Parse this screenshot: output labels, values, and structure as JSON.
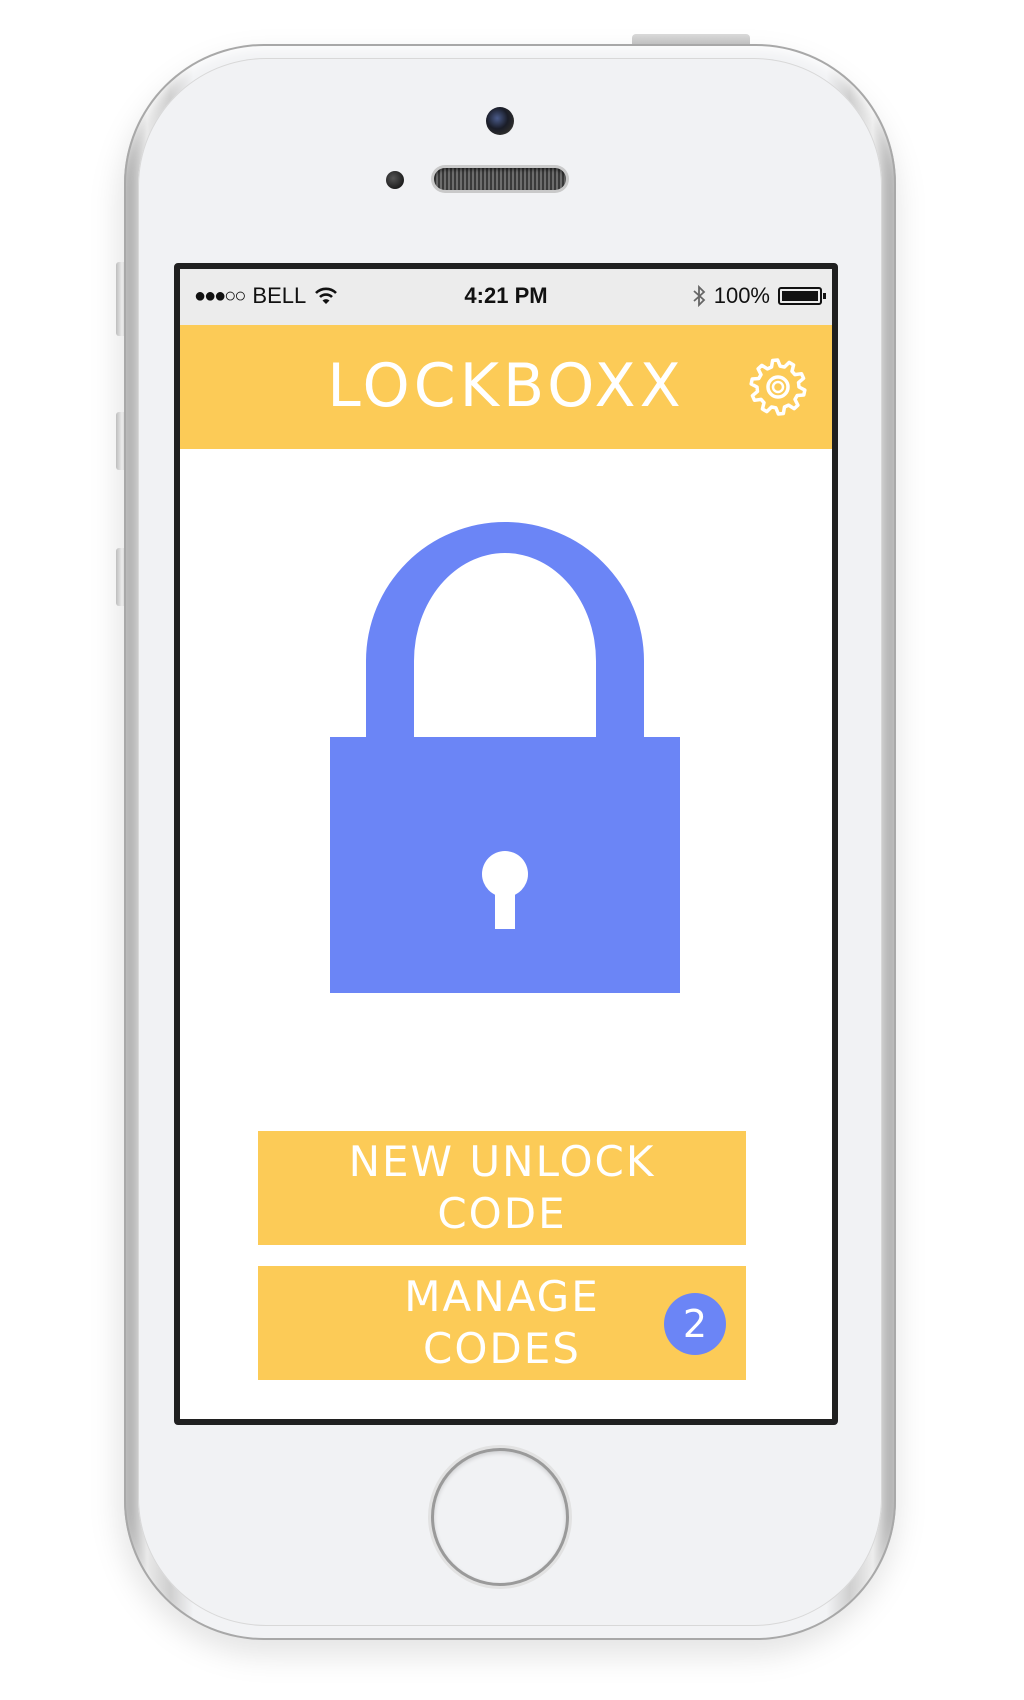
{
  "status_bar": {
    "carrier": "BELL",
    "time": "4:21 PM",
    "battery": "100%",
    "battery_level": 1.0,
    "signal_strength": 3,
    "icons": [
      "signal-dots-icon",
      "wifi-icon",
      "bluetooth-icon",
      "battery-icon"
    ]
  },
  "header": {
    "title": "LOCKBOXX",
    "settings_icon": "gear-icon"
  },
  "lock": {
    "icon": "padlock-icon",
    "state": "locked"
  },
  "buttons": {
    "new_code": "NEW UNLOCK CODE",
    "manage_codes": "MANAGE CODES",
    "manage_codes_count": "2"
  },
  "colors": {
    "header": "#fccb57",
    "button": "#fccb57",
    "lock": "#6b85f6",
    "badge": "#6b85f6"
  }
}
